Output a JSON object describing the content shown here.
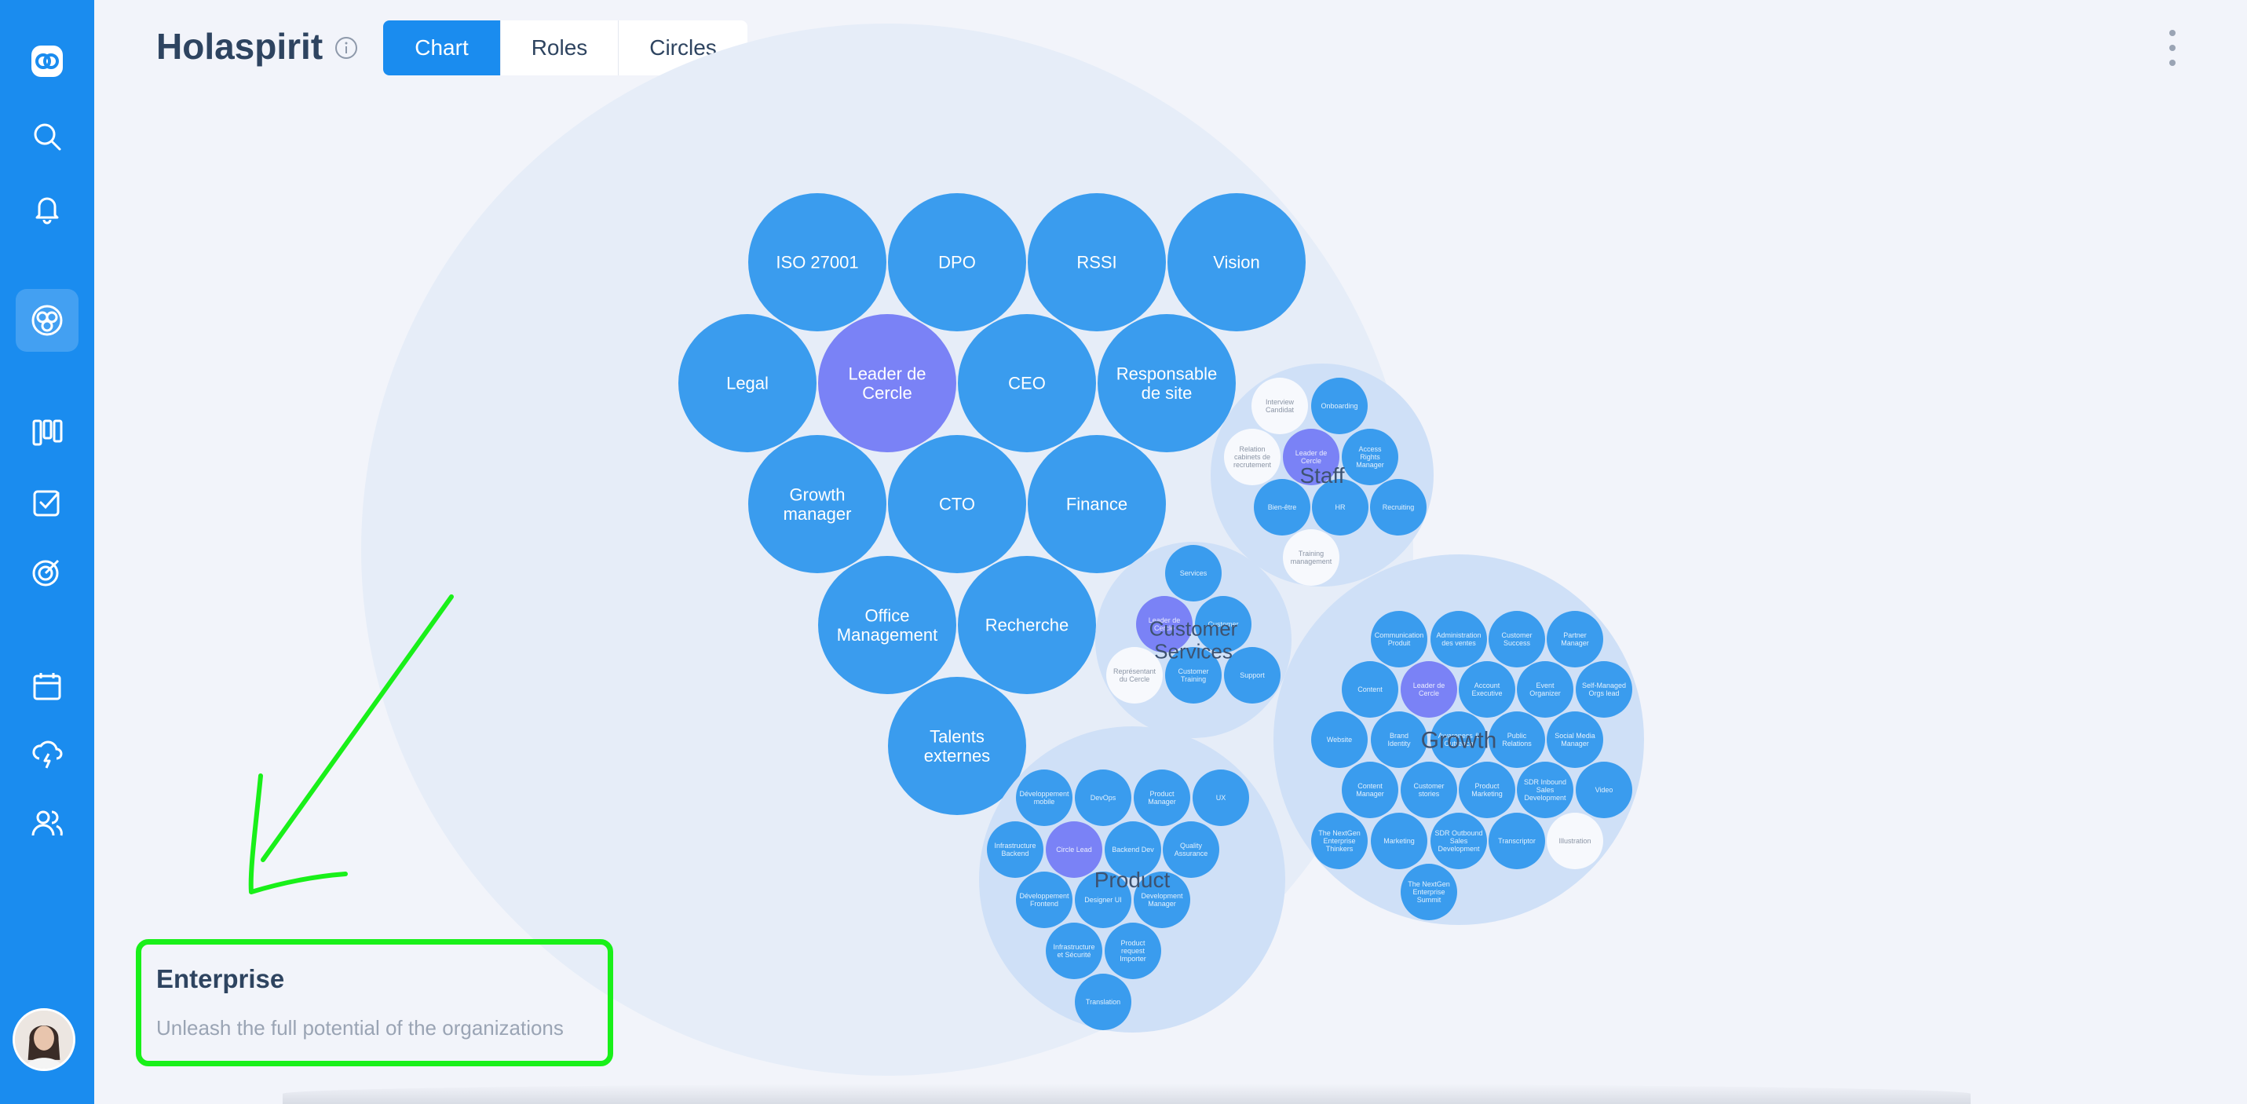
{
  "header": {
    "title": "Holaspirit",
    "tabs": [
      {
        "label": "Chart",
        "active": true
      },
      {
        "label": "Roles",
        "active": false
      },
      {
        "label": "Circles",
        "active": false
      }
    ]
  },
  "sidebar": {
    "icons": [
      "holaspirit-logo-icon",
      "search-icon",
      "bell-icon",
      "chart-circles-icon",
      "board-icon",
      "checkbox-icon",
      "target-icon",
      "calendar-icon",
      "lightning-cloud-icon",
      "users-icon"
    ]
  },
  "enterprise": {
    "title": "Enterprise",
    "subtitle": "Unleash the full potential of the organizations"
  },
  "colors": {
    "sidebar": "#1a8cef",
    "role": "#3a9cee",
    "leader": "#7a82f6",
    "outer_circle": "#e6edf8",
    "sub_circle": "#cfe0f7",
    "highlight": "#19f019"
  },
  "chart": {
    "main_roles": [
      {
        "label": "ISO 27001"
      },
      {
        "label": "DPO"
      },
      {
        "label": "RSSI"
      },
      {
        "label": "Vision"
      },
      {
        "label": "Legal"
      },
      {
        "label": "Leader de Cercle"
      },
      {
        "label": "CEO"
      },
      {
        "label": "Responsable de site"
      },
      {
        "label": "Growth manager"
      },
      {
        "label": "CTO"
      },
      {
        "label": "Finance"
      },
      {
        "label": "Office Management"
      },
      {
        "label": "Recherche"
      },
      {
        "label": "Talents externes"
      }
    ],
    "circles": [
      {
        "name": "Staff",
        "roles": [
          {
            "label": "Interview Candidat"
          },
          {
            "label": "Onboarding"
          },
          {
            "label": "Relation cabinets de recrutement"
          },
          {
            "label": "Leader de Cercle"
          },
          {
            "label": "Access Rights Manager"
          },
          {
            "label": "Bien-être"
          },
          {
            "label": "HR"
          },
          {
            "label": "Recruiting"
          },
          {
            "label": "Training management"
          }
        ]
      },
      {
        "name": "Customer Services",
        "roles": [
          {
            "label": "Services"
          },
          {
            "label": "Leader de Cercle"
          },
          {
            "label": "Customer"
          },
          {
            "label": "Représentant du Cercle"
          },
          {
            "label": "Customer Training"
          },
          {
            "label": "Support"
          }
        ]
      },
      {
        "name": "Growth",
        "roles": [
          {
            "label": "Communication Produit"
          },
          {
            "label": "Administration des ventes"
          },
          {
            "label": "Customer Success"
          },
          {
            "label": "Partner Manager"
          },
          {
            "label": "Content"
          },
          {
            "label": "Leader de Cercle"
          },
          {
            "label": "Account Executive"
          },
          {
            "label": "Event Organizer"
          },
          {
            "label": "Self-Managed Orgs lead"
          },
          {
            "label": "Website"
          },
          {
            "label": "Brand Identity"
          },
          {
            "label": "Awareness & Outreach"
          },
          {
            "label": "Public Relations"
          },
          {
            "label": "Social Media Manager"
          },
          {
            "label": "Content Manager"
          },
          {
            "label": "Customer stories"
          },
          {
            "label": "Product Marketing"
          },
          {
            "label": "SDR Inbound Sales Development"
          },
          {
            "label": "Video"
          },
          {
            "label": "The NextGen Enterprise Thinkers"
          },
          {
            "label": "Marketing"
          },
          {
            "label": "SDR Outbound Sales Development"
          },
          {
            "label": "Transcriptor"
          },
          {
            "label": "Illustration"
          },
          {
            "label": "The NextGen Enterprise Summit"
          }
        ]
      },
      {
        "name": "Product",
        "roles": [
          {
            "label": "Développement mobile"
          },
          {
            "label": "DevOps"
          },
          {
            "label": "Product Manager"
          },
          {
            "label": "UX"
          },
          {
            "label": "Infrastructure Backend"
          },
          {
            "label": "Circle Lead"
          },
          {
            "label": "Backend Dev"
          },
          {
            "label": "Quality Assurance"
          },
          {
            "label": "Développement Frontend"
          },
          {
            "label": "Designer UI"
          },
          {
            "label": "Development Manager"
          },
          {
            "label": "Infrastructure et Sécurité"
          },
          {
            "label": "Product request Importer"
          },
          {
            "label": "Translation"
          }
        ]
      }
    ]
  }
}
